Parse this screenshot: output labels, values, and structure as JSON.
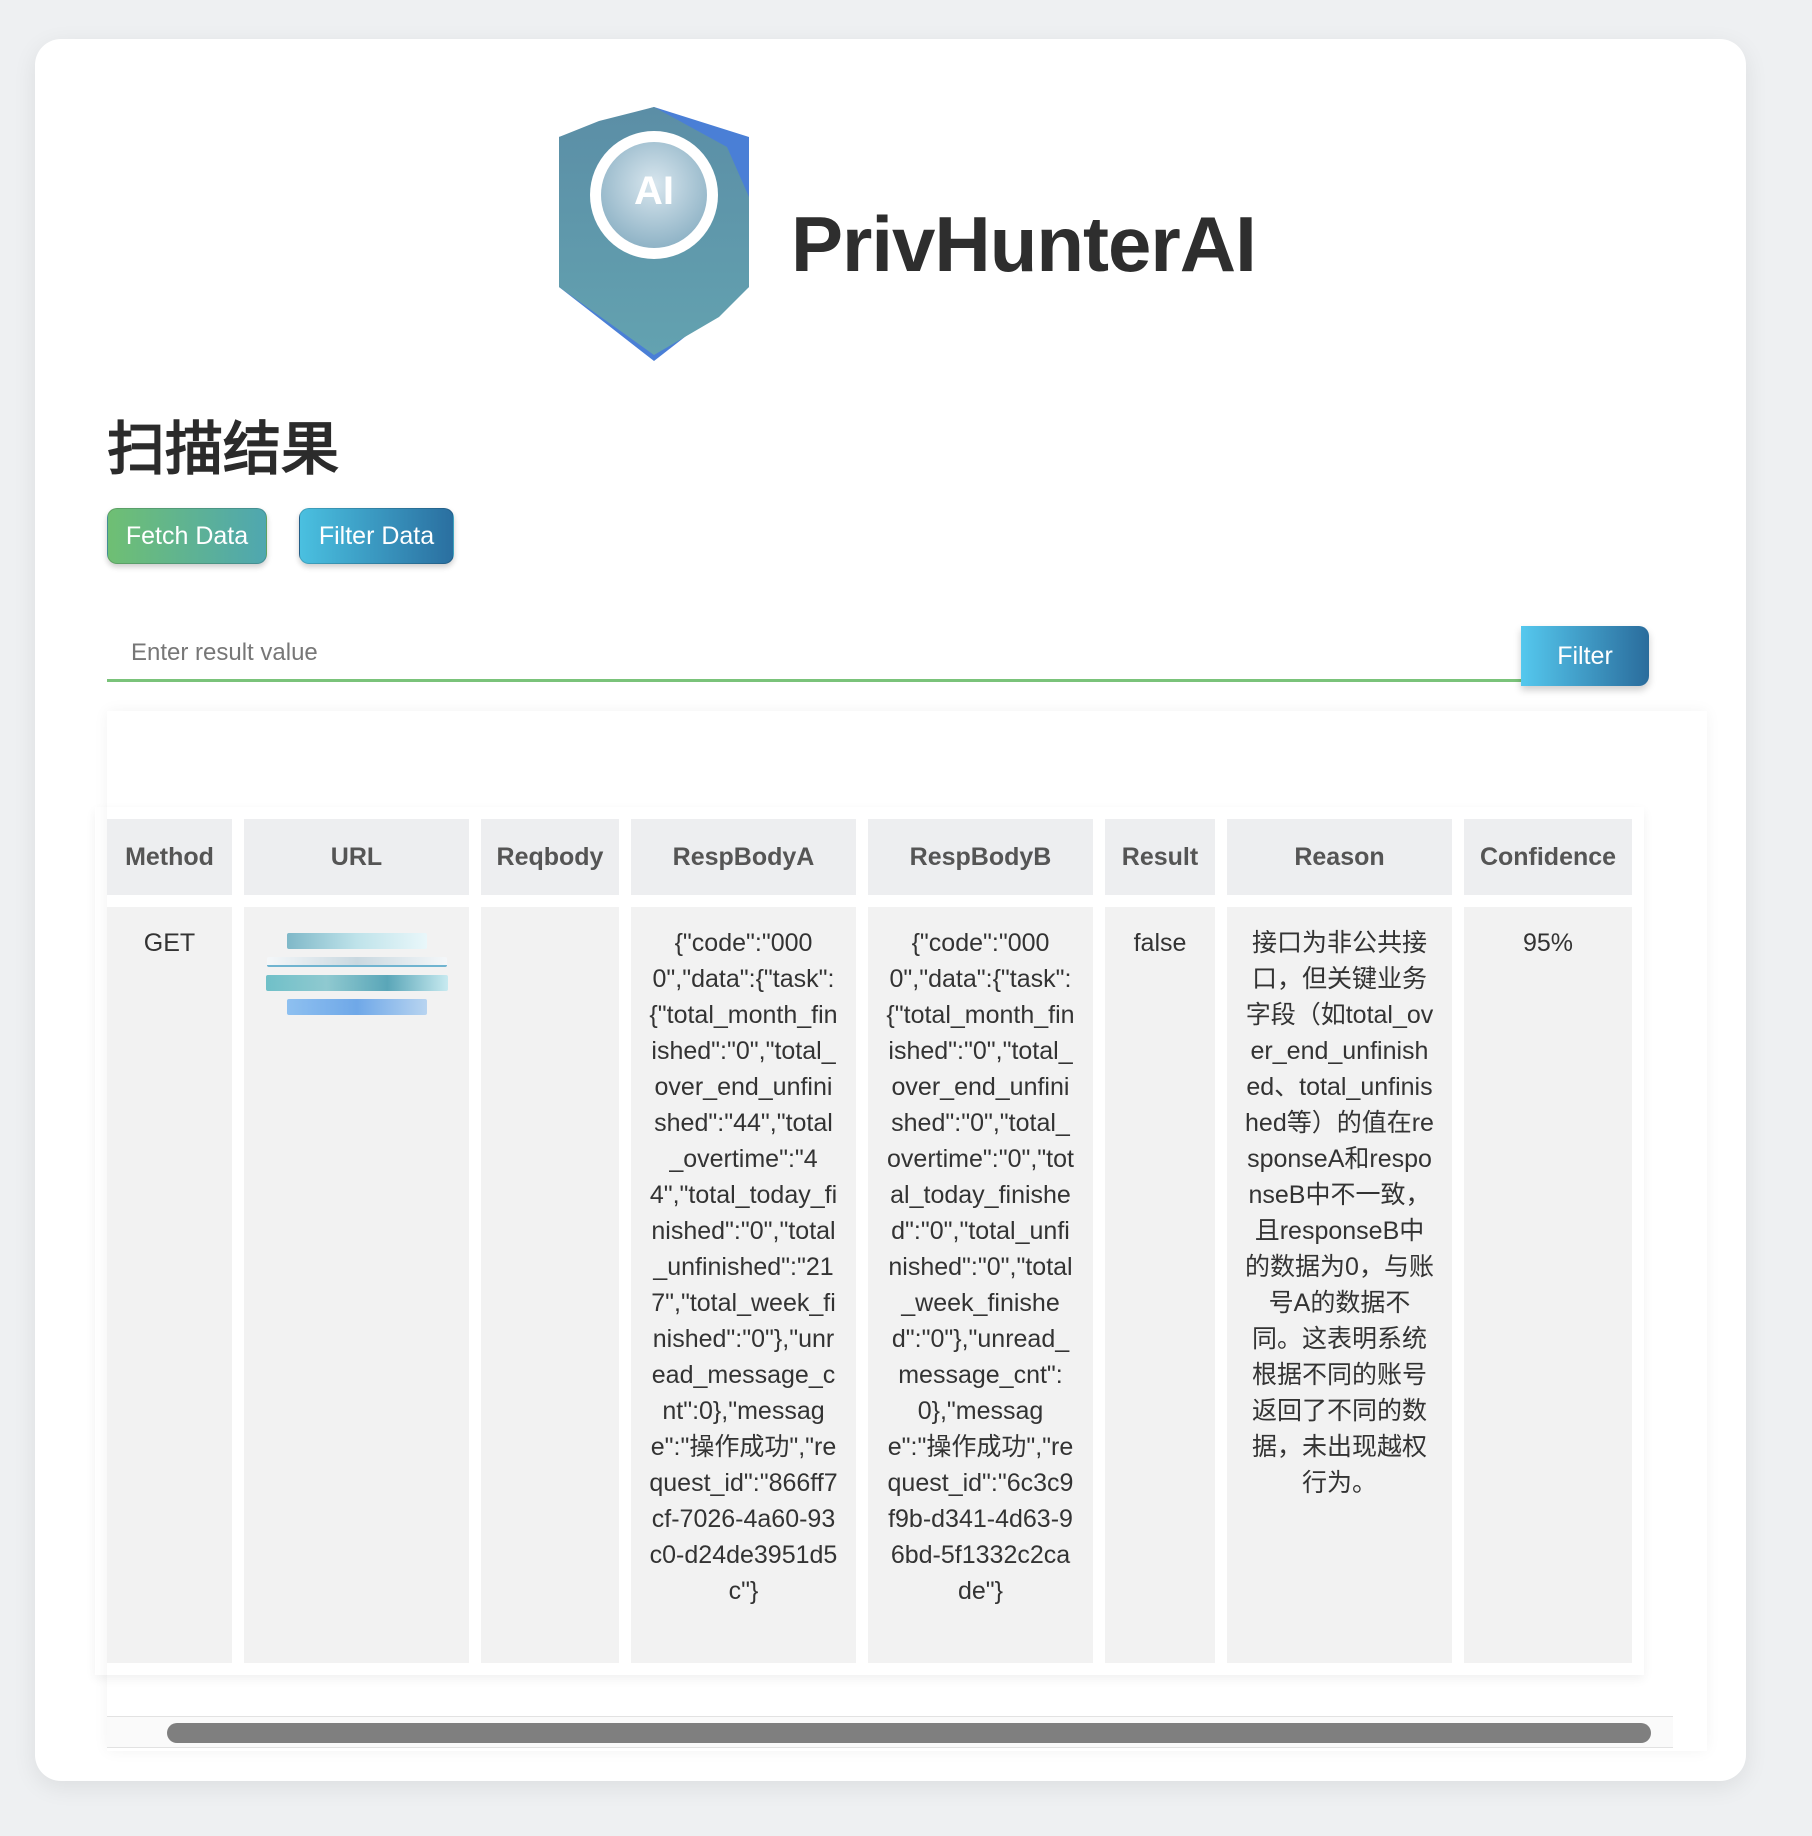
{
  "brand": {
    "name": "PrivHunterAI",
    "logo_text": "AI"
  },
  "page": {
    "title": "扫描结果"
  },
  "toolbar": {
    "fetch_label": "Fetch Data",
    "filter_data_label": "Filter Data"
  },
  "filter": {
    "placeholder": "Enter result value",
    "value": "",
    "button_label": "Filter"
  },
  "table": {
    "headers": [
      "Method",
      "URL",
      "Reqbody",
      "RespBodyA",
      "RespBodyB",
      "Result",
      "Reason",
      "Confidence"
    ],
    "rows": [
      {
        "method": "GET",
        "url": "",
        "reqbody": "",
        "resp_a": "{\"code\":\"0000\",\"data\":{\"task\":{\"total_month_finished\":\"0\",\"total_over_end_unfinished\":\"44\",\"total_overtime\":\"44\",\"total_today_finished\":\"0\",\"total_unfinished\":\"217\",\"total_week_finished\":\"0\"},\"unread_message_cnt\":0},\"message\":\"操作成功\",\"request_id\":\"866ff7cf-7026-4a60-93c0-d24de3951d5c\"}",
        "resp_b": "{\"code\":\"0000\",\"data\":{\"task\":{\"total_month_finished\":\"0\",\"total_over_end_unfinished\":\"0\",\"total_overtime\":\"0\",\"total_today_finished\":\"0\",\"total_unfinished\":\"0\",\"total_week_finished\":\"0\"},\"unread_message_cnt\":0},\"message\":\"操作成功\",\"request_id\":\"6c3c9f9b-d341-4d63-96bd-5f1332c2cade\"}",
        "result": "false",
        "reason": "接口为非公共接口，但关键业务字段（如total_over_end_unfinished、total_unfinished等）的值在responseA和responseB中不一致，且responseB中的数据为0，与账号A的数据不同。这表明系统根据不同的账号返回了不同的数据，未出现越权行为。",
        "confidence": "95%"
      }
    ]
  },
  "colors": {
    "accent_green": "#7ac37a",
    "accent_blue": "#2a6c9c",
    "header_bg": "#edeef0",
    "cell_bg": "#f2f2f2"
  }
}
